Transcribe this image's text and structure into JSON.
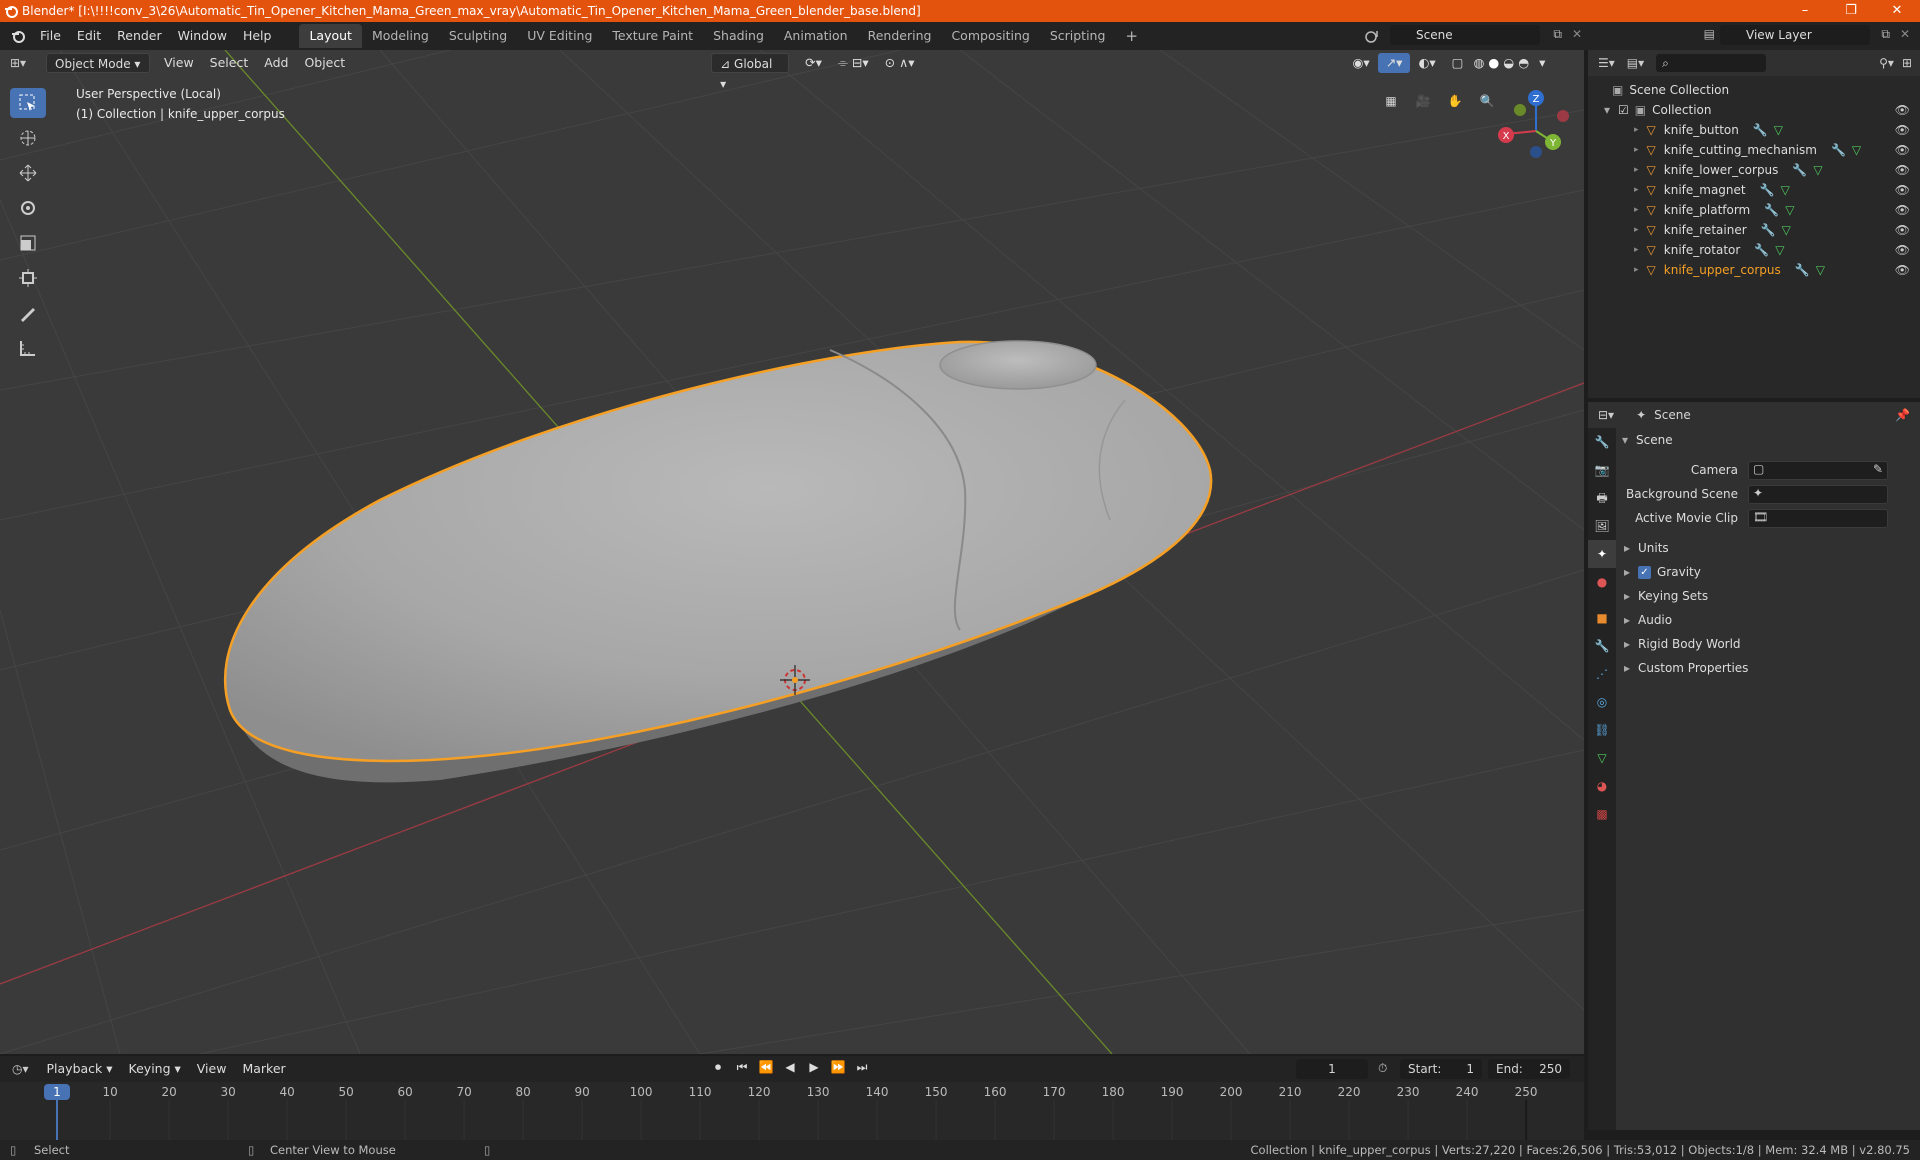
{
  "window": {
    "title": "Blender* [I:\\!!!!conv_3\\26\\Automatic_Tin_Opener_Kitchen_Mama_Green_max_vray\\Automatic_Tin_Opener_Kitchen_Mama_Green_blender_base.blend]"
  },
  "menu": [
    "File",
    "Edit",
    "Render",
    "Window",
    "Help"
  ],
  "workspaces": [
    "Layout",
    "Modeling",
    "Sculpting",
    "UV Editing",
    "Texture Paint",
    "Shading",
    "Animation",
    "Rendering",
    "Compositing",
    "Scripting"
  ],
  "scene_name": "Scene",
  "view_layer": "View Layer",
  "viewport": {
    "mode": "Object Mode",
    "menus": [
      "View",
      "Select",
      "Add",
      "Object"
    ],
    "orientation": "Global",
    "info_line1": "User Perspective (Local)",
    "info_line2": "(1) Collection | knife_upper_corpus",
    "axes": {
      "x": "X",
      "y": "Y",
      "z": "Z"
    }
  },
  "outliner": {
    "root": "Scene Collection",
    "collection": "Collection",
    "objects": [
      {
        "name": "knife_button",
        "selected": false
      },
      {
        "name": "knife_cutting_mechanism",
        "selected": false
      },
      {
        "name": "knife_lower_corpus",
        "selected": false
      },
      {
        "name": "knife_magnet",
        "selected": false
      },
      {
        "name": "knife_platform",
        "selected": false
      },
      {
        "name": "knife_retainer",
        "selected": false
      },
      {
        "name": "knife_rotator",
        "selected": false
      },
      {
        "name": "knife_upper_corpus",
        "selected": true
      }
    ]
  },
  "properties": {
    "header": "Scene",
    "panel": "Scene",
    "fields": [
      {
        "label": "Camera"
      },
      {
        "label": "Background Scene"
      },
      {
        "label": "Active Movie Clip"
      }
    ],
    "subpanels": [
      "Units",
      "Gravity",
      "Keying Sets",
      "Audio",
      "Rigid Body World",
      "Custom Properties"
    ]
  },
  "timeline": {
    "menus": [
      "Playback",
      "Keying",
      "View",
      "Marker"
    ],
    "current_frame": "1",
    "start_label": "Start:",
    "start": "1",
    "end_label": "End:",
    "end": "250",
    "ticks": [
      "1",
      "10",
      "20",
      "30",
      "40",
      "50",
      "60",
      "70",
      "80",
      "90",
      "100",
      "110",
      "120",
      "130",
      "140",
      "150",
      "160",
      "170",
      "180",
      "190",
      "200",
      "210",
      "220",
      "230",
      "240",
      "250"
    ]
  },
  "statusbar": {
    "left": "Select",
    "middle": "Center View to Mouse",
    "right": "Collection | knife_upper_corpus | Verts:27,220 | Faces:26,506 | Tris:53,012 | Objects:1/8 | Mem: 32.4 MB | v2.80.75"
  },
  "colors": {
    "accent": "#4772b3",
    "selection_outline": "#f5a025",
    "title_bar": "#e3530e"
  }
}
